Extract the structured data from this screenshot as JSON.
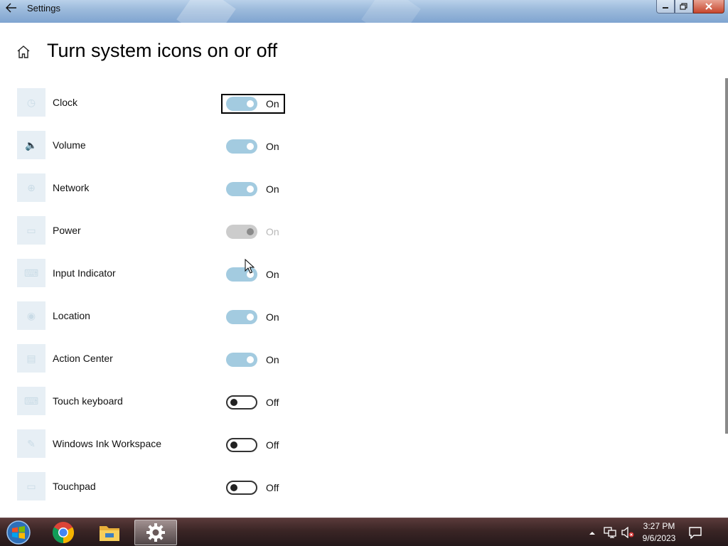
{
  "window": {
    "title": "Settings",
    "back_icon": "back-arrow-icon",
    "minimize_icon": "minimize-icon",
    "maximize_icon": "maximize-icon",
    "close_icon": "close-icon"
  },
  "header": {
    "home_icon": "home-icon",
    "title": "Turn system icons on or off"
  },
  "system_icons": [
    {
      "label": "Clock",
      "icon": "clock-icon",
      "state": "On",
      "toggle": "on",
      "focused": true
    },
    {
      "label": "Volume",
      "icon": "volume-icon",
      "state": "On",
      "toggle": "on",
      "focused": false
    },
    {
      "label": "Network",
      "icon": "network-icon",
      "state": "On",
      "toggle": "on",
      "focused": false
    },
    {
      "label": "Power",
      "icon": "power-battery-icon",
      "state": "On",
      "toggle": "disabled",
      "focused": false
    },
    {
      "label": "Input Indicator",
      "icon": "keyboard-icon",
      "state": "On",
      "toggle": "on",
      "focused": false
    },
    {
      "label": "Location",
      "icon": "location-icon",
      "state": "On",
      "toggle": "on",
      "focused": false
    },
    {
      "label": "Action Center",
      "icon": "action-center-icon",
      "state": "On",
      "toggle": "on",
      "focused": false
    },
    {
      "label": "Touch keyboard",
      "icon": "touch-keyboard-icon",
      "state": "Off",
      "toggle": "off",
      "focused": false
    },
    {
      "label": "Windows Ink Workspace",
      "icon": "pen-icon",
      "state": "Off",
      "toggle": "off",
      "focused": false
    },
    {
      "label": "Touchpad",
      "icon": "touchpad-icon",
      "state": "Off",
      "toggle": "off",
      "focused": false
    }
  ],
  "colors": {
    "toggle_on": "#a3cbe0",
    "toggle_disabled": "#cccccc",
    "toggle_off_border": "#333333",
    "titlebar": "#9dbbdc",
    "taskbar": "#3a2525"
  },
  "taskbar": {
    "start_icon": "windows-start-icon",
    "apps": [
      {
        "name": "chrome-icon",
        "active": false
      },
      {
        "name": "file-explorer-icon",
        "active": false
      },
      {
        "name": "settings-gear-icon",
        "active": true
      }
    ],
    "tray_icons": [
      "show-hidden-icons-icon",
      "network-icon",
      "volume-muted-icon"
    ],
    "time": "3:27 PM",
    "date": "9/6/2023",
    "notification_icon": "action-center-icon"
  }
}
